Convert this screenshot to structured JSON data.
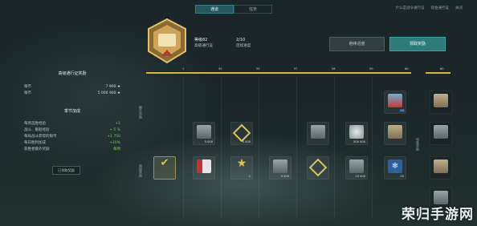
{
  "tabs": [
    {
      "label": "通道"
    },
    {
      "label": "任务"
    }
  ],
  "top_right": [
    "什么是战令通行证",
    "现金通行证",
    "关闭"
  ],
  "level": {
    "label": "等级82",
    "sub": "高级通行证"
  },
  "progress": {
    "label": "2/10",
    "sub": "后续进度"
  },
  "buttons": {
    "secondary": "继续进度",
    "primary": "领取奖励"
  },
  "rewards_panel": {
    "title": "高级通行证奖励",
    "rows": [
      {
        "k": "银币",
        "v": "7 900 ★"
      },
      {
        "k": "银币",
        "v": "5 000 900 ★"
      }
    ],
    "season_title": "季节加成",
    "season_rows": [
      {
        "k": "每周首胜经验",
        "v": "+1"
      },
      {
        "k": "战斗、舰船经验",
        "v": "+ 5 %"
      },
      {
        "k": "每局战斗获得的银币",
        "v": "+1 750"
      },
      {
        "k": "每日胜利加成",
        "v": "+10%"
      },
      {
        "k": "获胜者额外奖励",
        "v": "每周"
      }
    ],
    "tag": "已领取奖励"
  },
  "track_marks": [
    "1",
    "55",
    "55",
    "57",
    "58",
    "59",
    "60"
  ],
  "track2_mark": "60",
  "row_labels": {
    "top": "额外奖励",
    "bottom": "高级奖励",
    "right": "特殊奖励"
  },
  "rewards": {
    "avatar_q": "10",
    "r1": [
      {
        "q": "5 000"
      },
      {
        "q": "5 000"
      },
      {
        "q": ""
      },
      {
        "q": "500 000"
      },
      {
        "q": ""
      },
      {
        "q": ""
      }
    ],
    "r2": [
      {
        "q": ""
      },
      {
        "q": "1"
      },
      {
        "q": "5 000"
      },
      {
        "q": ""
      },
      {
        "q": "10 000"
      },
      {
        "q": "25"
      }
    ]
  },
  "watermark": "荣归手游网"
}
